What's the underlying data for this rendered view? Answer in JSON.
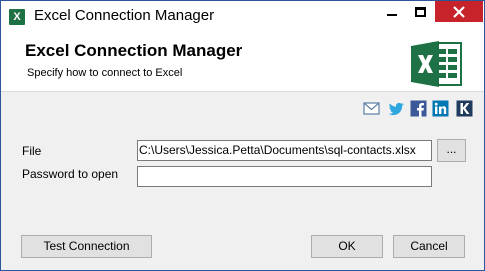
{
  "window": {
    "title": "Excel Connection Manager",
    "app_icon_glyph": "X",
    "accent_color": "#2b579a",
    "close_color": "#c7232b"
  },
  "header": {
    "title": "Excel Connection Manager",
    "subtitle": "Specify how to connect to Excel",
    "logo_icon": "excel-logo-icon",
    "logo_color": "#1e7145"
  },
  "social": {
    "icons": [
      "mail-icon",
      "twitter-icon",
      "facebook-icon",
      "linkedin-icon",
      "k-icon"
    ]
  },
  "form": {
    "file_label": "File",
    "file_value": "C:\\Users\\Jessica.Petta\\Documents\\sql-contacts.xlsx",
    "browse_label": "...",
    "password_label": "Password to open",
    "password_value": ""
  },
  "footer": {
    "test_connection_label": "Test Connection",
    "ok_label": "OK",
    "cancel_label": "Cancel"
  }
}
